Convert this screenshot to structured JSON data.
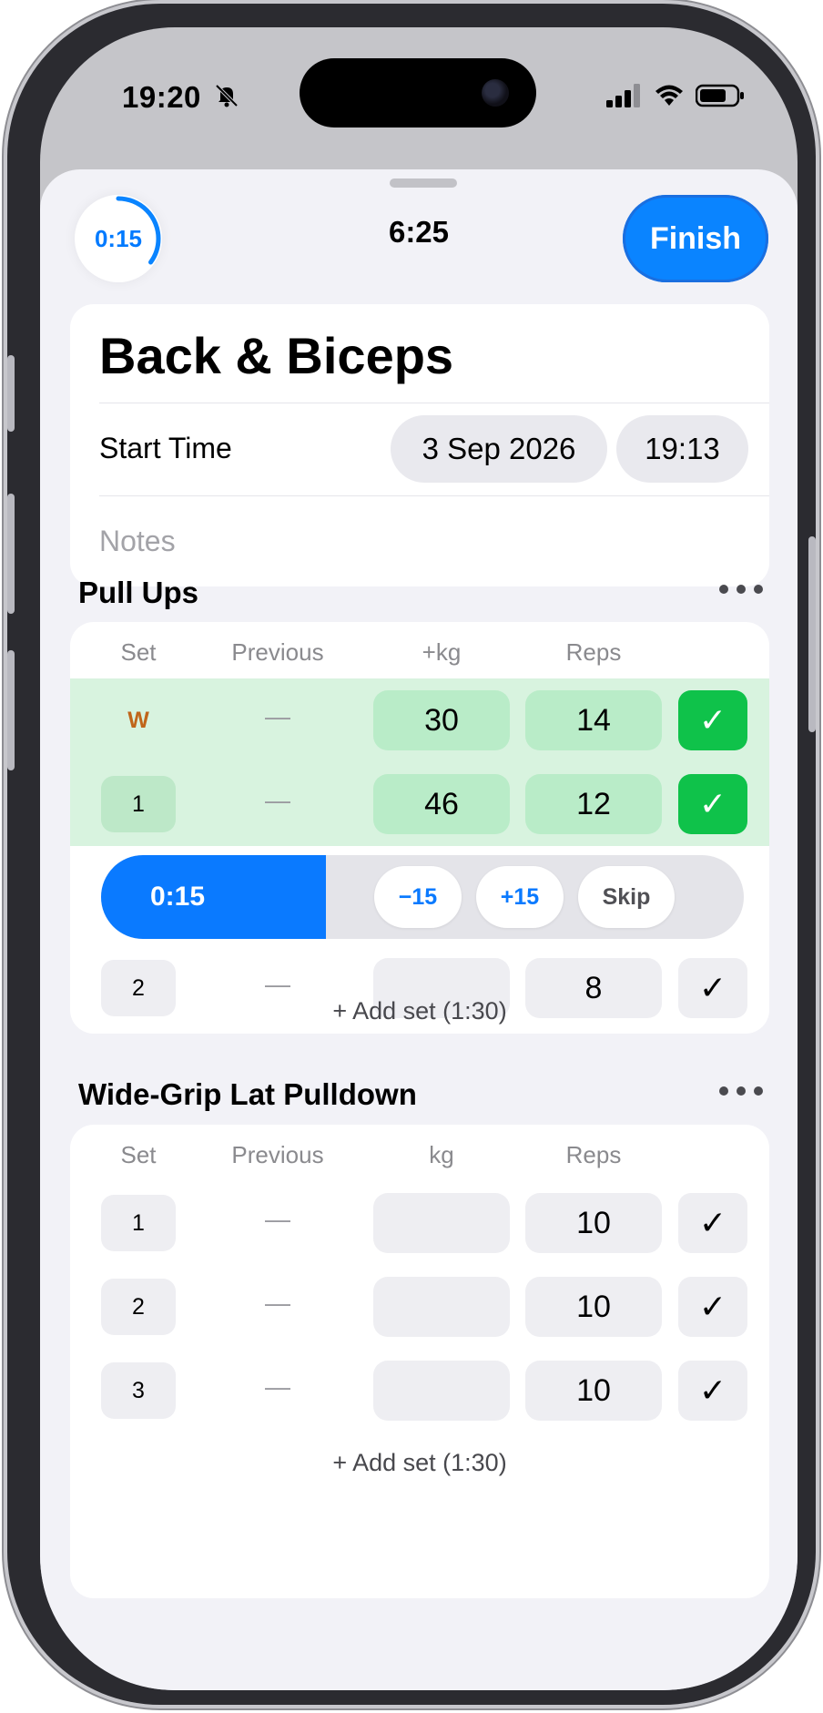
{
  "status_bar": {
    "time": "19:20"
  },
  "header": {
    "rest_timer": "0:15",
    "rest_progress": 0.35,
    "elapsed": "6:25",
    "finish_label": "Finish"
  },
  "workout": {
    "title": "Back & Biceps",
    "start_time_label": "Start Time",
    "start_date": "3 Sep 2026",
    "start_clock": "19:13",
    "notes_placeholder": "Notes"
  },
  "exercises": [
    {
      "name": "Pull Ups",
      "columns": [
        "Set",
        "Previous",
        "+kg",
        "Reps"
      ],
      "sets": [
        {
          "set": "W",
          "previous": "—",
          "kg": "30",
          "reps": "14",
          "check": "✓"
        },
        {
          "set": "1",
          "previous": "—",
          "kg": "46",
          "reps": "12",
          "check": "✓"
        },
        {
          "set": "2",
          "previous": "—",
          "kg": "",
          "reps": "8",
          "check": "✓"
        }
      ],
      "rest": {
        "time": "0:15",
        "progress": 0.35,
        "minus": "−15",
        "plus": "+15",
        "skip": "Skip"
      },
      "add_set": "+ Add set (1:30)"
    },
    {
      "name": "Wide-Grip Lat Pulldown",
      "columns": [
        "Set",
        "Previous",
        "kg",
        "Reps"
      ],
      "sets": [
        {
          "set": "1",
          "previous": "—",
          "kg": "",
          "reps": "10",
          "check": "✓"
        },
        {
          "set": "2",
          "previous": "—",
          "kg": "",
          "reps": "10",
          "check": "✓"
        },
        {
          "set": "3",
          "previous": "—",
          "kg": "",
          "reps": "10",
          "check": "✓"
        }
      ],
      "add_set": "+ Add set (1:30)"
    }
  ],
  "colors": {
    "accent": "#0a84ff",
    "done_green": "#0fc24a",
    "done_row": "#d8f3df",
    "warmup": "#c0651a"
  }
}
